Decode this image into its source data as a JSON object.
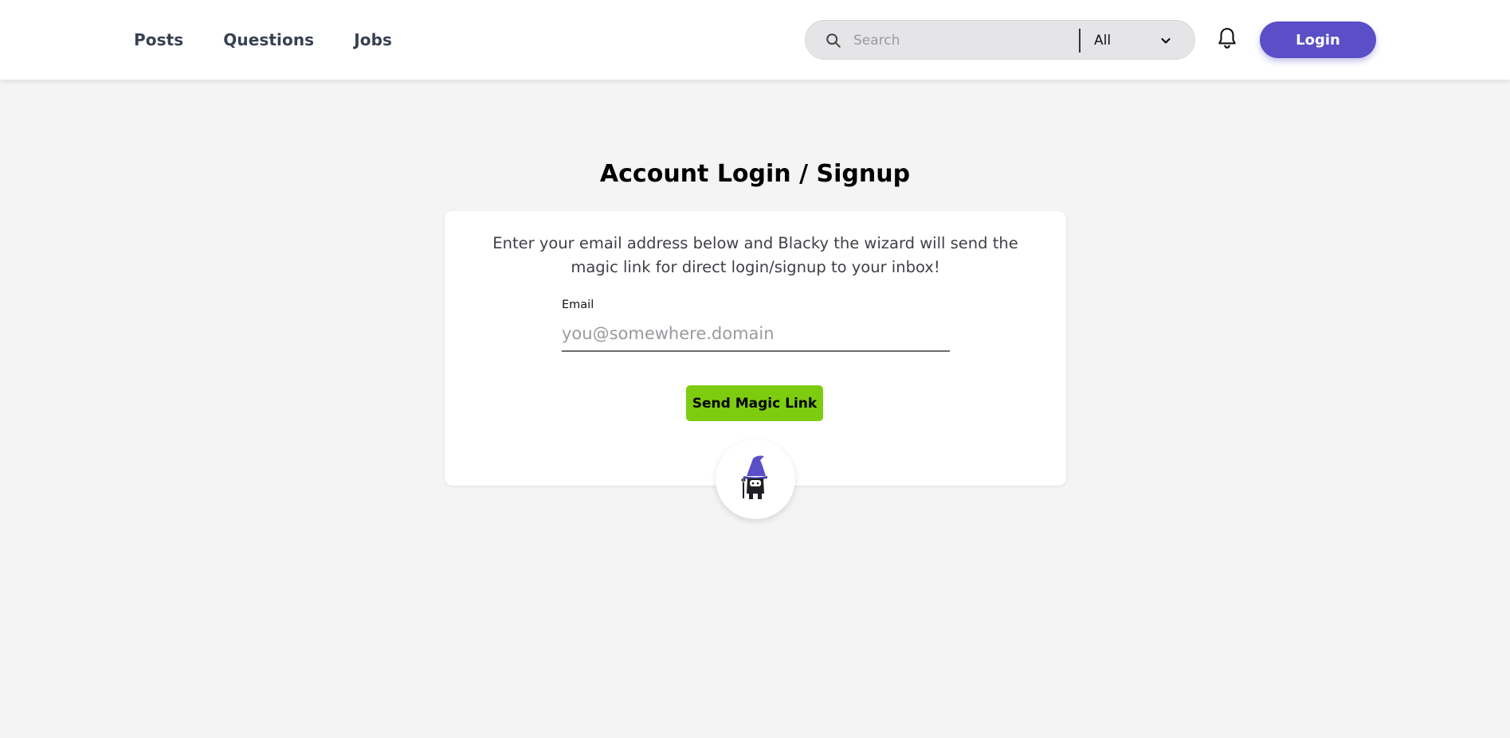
{
  "header": {
    "nav": [
      {
        "label": "Posts"
      },
      {
        "label": "Questions"
      },
      {
        "label": "Jobs"
      }
    ],
    "search": {
      "placeholder": "Search",
      "scope": "All"
    },
    "login_label": "Login"
  },
  "main": {
    "title": "Account Login / Signup",
    "intro": "Enter your email address below and Blacky the wizard will send the magic link for direct login/signup to your inbox!",
    "email_label": "Email",
    "email_placeholder": "you@somewhere.domain",
    "send_label": "Send Magic Link"
  },
  "colors": {
    "accent": "#5b4fc7",
    "primary_action": "#7ecc10",
    "background": "#f4f4f4"
  },
  "icons": [
    "search-icon",
    "chevron-down-icon",
    "bell-icon",
    "wizard-mascot-icon"
  ]
}
